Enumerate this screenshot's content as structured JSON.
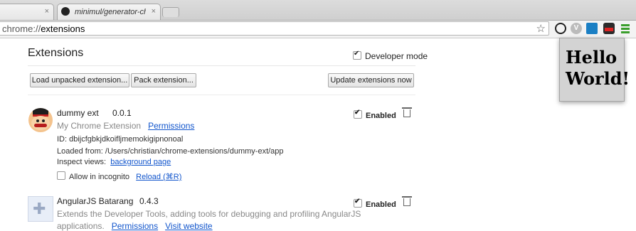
{
  "tabs": [
    {
      "title": "",
      "close": "×"
    },
    {
      "title": "minimul/generator-chrome",
      "close": "×"
    }
  ],
  "omnibox": {
    "scheme": "chrome://",
    "path": "extensions",
    "star": "☆"
  },
  "toolbar_icons": [
    "circle-icon",
    "v-icon",
    "screen-icon",
    "mustache-man-icon",
    "menu-icon"
  ],
  "popup": {
    "line1": "Hello",
    "line2": "World!"
  },
  "page": {
    "title": "Extensions",
    "developer_mode_label": "Developer mode",
    "developer_mode_checked": true,
    "buttons": {
      "load_unpacked": "Load unpacked extension...",
      "pack": "Pack extension...",
      "update": "Update extensions now"
    }
  },
  "extensions": [
    {
      "name": "dummy ext",
      "version": "0.0.1",
      "description": "My Chrome Extension",
      "permissions_link": "Permissions",
      "id_label": "ID:",
      "id": "dbijcfgbkjdkoifljmemokigipnonoal",
      "loaded_from_label": "Loaded from:",
      "loaded_from": "/Users/christian/chrome-extensions/dummy-ext/app",
      "inspect_label": "Inspect views:",
      "inspect_link": "background page",
      "incognito_label": "Allow in incognito",
      "reload_link": "Reload (⌘R)",
      "enabled_label": "Enabled",
      "enabled": true
    },
    {
      "name": "AngularJS Batarang",
      "version": "0.4.3",
      "description_line1": "Extends the Developer Tools, adding tools for debugging and profiling AngularJS",
      "description_line2": "applications.",
      "permissions_link": "Permissions",
      "website_link": "Visit website",
      "enabled_label": "Enabled",
      "enabled": true
    }
  ],
  "colors": {
    "link": "#1155cc",
    "menu_green": "#3a9e2c",
    "popup_bg": "#d3d3d3"
  }
}
